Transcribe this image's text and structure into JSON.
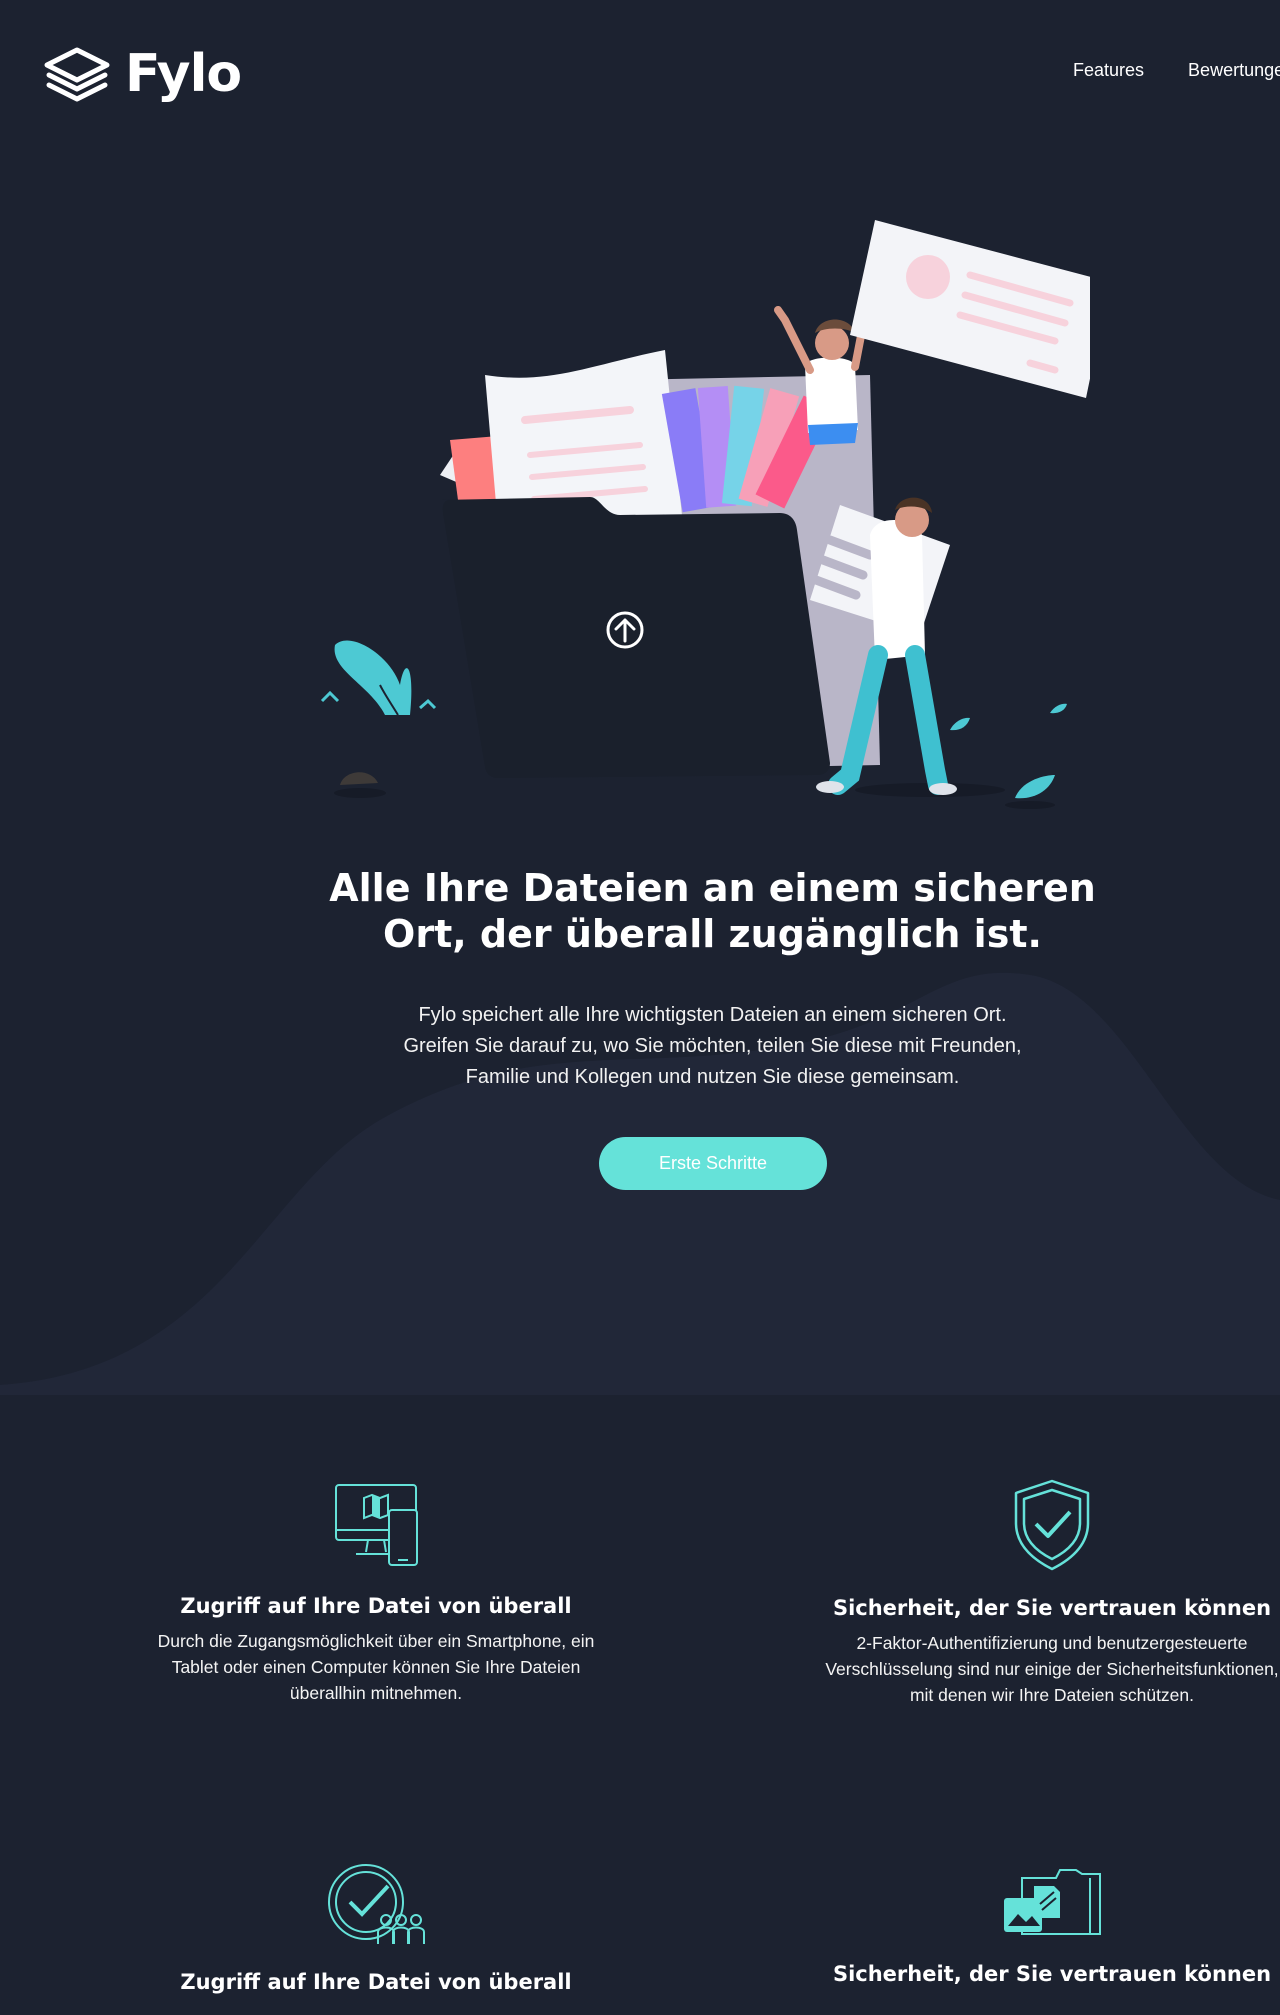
{
  "header": {
    "logo_text": "Fylo",
    "nav": [
      "Features",
      "Bewertungen"
    ]
  },
  "hero": {
    "title_line1": "Alle Ihre Dateien an einem sicheren",
    "title_line2": "Ort, der überall zugänglich ist.",
    "text_line1": "Fylo speichert alle Ihre wichtigsten Dateien an einem sicheren Ort.",
    "text_line2": "Greifen Sie darauf zu, wo Sie möchten, teilen Sie diese mit Freunden,",
    "text_line3": "Familie und Kollegen und nutzen Sie diese gemeinsam.",
    "cta_label": "Erste Schritte"
  },
  "features": [
    {
      "icon": "devices-icon",
      "title": "Zugriff auf Ihre Datei von überall",
      "text_lines": [
        "Durch die Zugangsmöglichkeit über ein Smartphone, ein",
        "Tablet oder einen Computer können Sie Ihre Dateien",
        "überallhin mitnehmen."
      ]
    },
    {
      "icon": "shield-check-icon",
      "title": "Sicherheit, der Sie vertrauen können",
      "text_lines": [
        "2-Faktor-Authentifizierung und benutzergesteuerte",
        "Verschlüsselung sind nur einige der Sicherheitsfunktionen,",
        "mit denen wir Ihre Dateien schützen."
      ]
    },
    {
      "icon": "collaboration-icon",
      "title": "Zugriff auf Ihre Datei von überall"
    },
    {
      "icon": "files-folder-icon",
      "title": "Sicherheit, der Sie vertrauen können"
    }
  ],
  "colors": {
    "background": "#1c2230",
    "background_curve": "#202636",
    "accent": "#65e2d9"
  }
}
